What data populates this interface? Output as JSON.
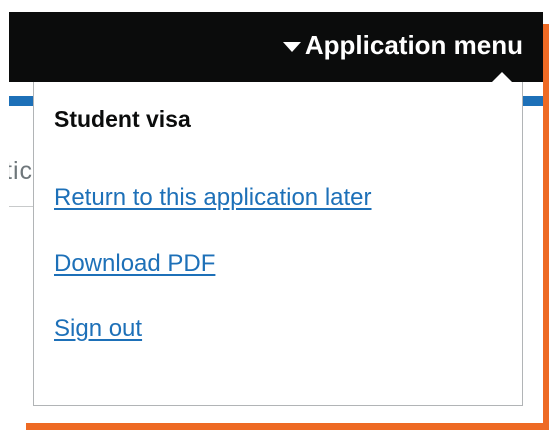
{
  "header": {
    "menu_label": "Application menu"
  },
  "background": {
    "partial_text": "tic"
  },
  "menu": {
    "title": "Student visa",
    "links": [
      "Return to this application later",
      "Download PDF",
      "Sign out"
    ]
  },
  "colors": {
    "header_bg": "#0b0c0c",
    "link": "#1d70b8",
    "stripe": "#1d70b8",
    "frame": "#ee6a24"
  }
}
